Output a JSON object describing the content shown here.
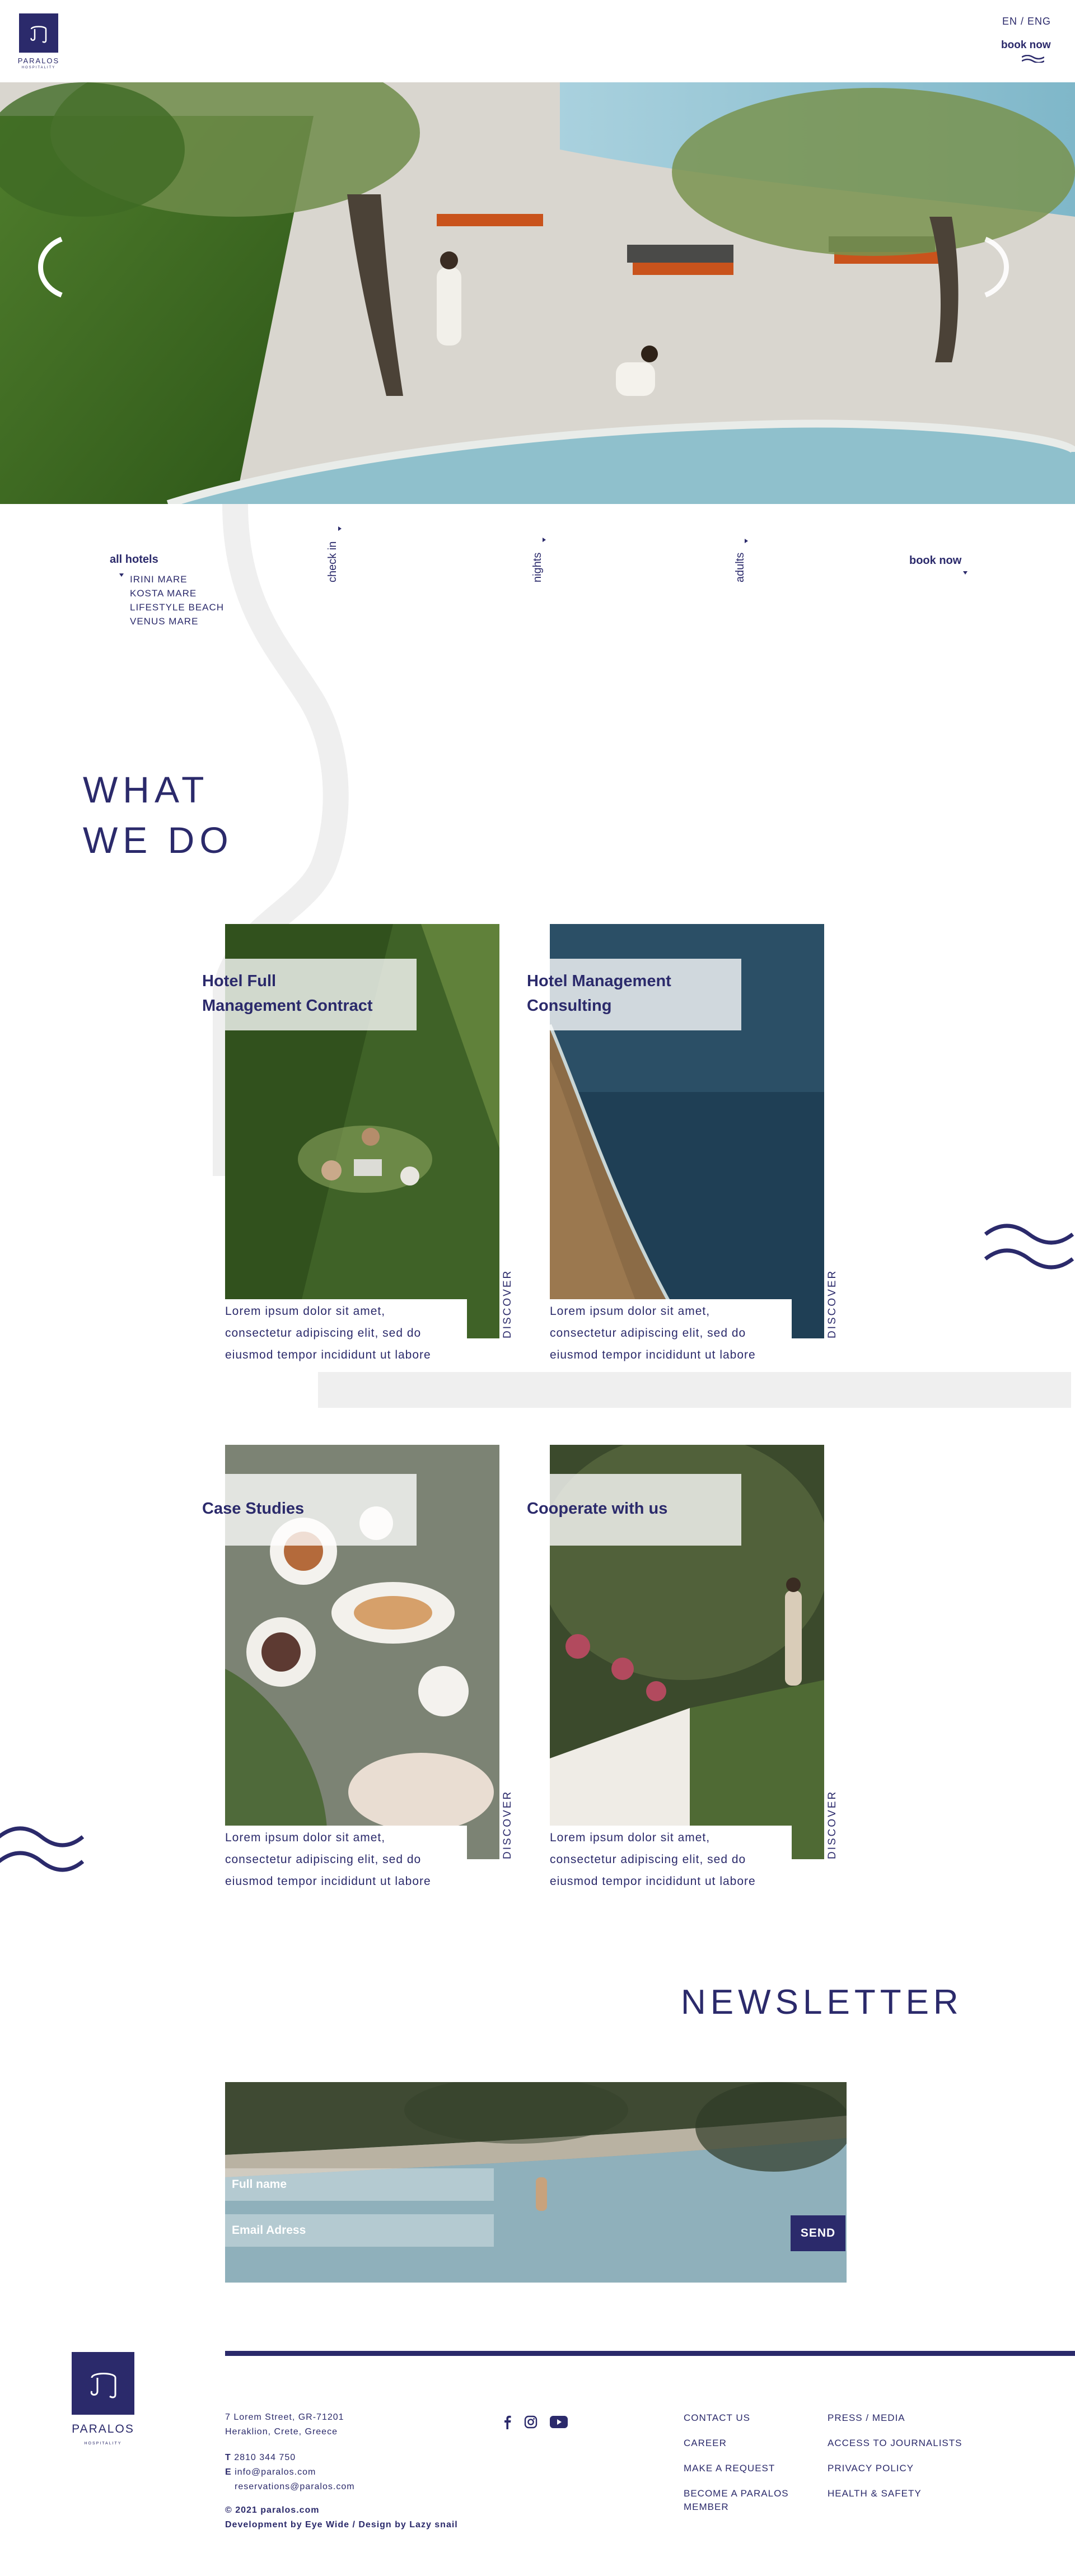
{
  "header": {
    "logo_text": "PARALOS",
    "logo_subtext": "HOSPITALITY",
    "language": "EN / ENG",
    "book_now": "book now"
  },
  "booking": {
    "hotels_label": "all hotels",
    "hotels": [
      "IRINI MARE",
      "KOSTA MARE",
      "LIFESTYLE BEACH",
      "VENUS MARE"
    ],
    "check_in": "check in",
    "nights": "nights",
    "adults": "adults",
    "book_now": "book now"
  },
  "what_we_do": {
    "title_line1": "WHAT",
    "title_line2": "WE DO",
    "cards": [
      {
        "title_line1": "Hotel Full",
        "title_line2": "Management Contract",
        "text_lines": [
          "Lorem ipsum dolor sit amet,",
          "consectetur adipiscing elit, sed do",
          "eiusmod tempor incididunt ut labore"
        ],
        "discover": "DISCOVER"
      },
      {
        "title_line1": "Hotel Management",
        "title_line2": "Consulting",
        "text_lines": [
          "Lorem ipsum dolor sit amet,",
          "consectetur adipiscing elit, sed do",
          "eiusmod tempor incididunt ut labore"
        ],
        "discover": "DISCOVER"
      },
      {
        "title_line1": "Case Studies",
        "title_line2": "",
        "text_lines": [
          "Lorem ipsum dolor sit amet,",
          "consectetur adipiscing elit, sed do",
          "eiusmod tempor incididunt ut labore"
        ],
        "discover": "DISCOVER"
      },
      {
        "title_line1": "Cooperate with us",
        "title_line2": "",
        "text_lines": [
          "Lorem ipsum dolor sit amet,",
          "consectetur adipiscing elit, sed do",
          "eiusmod tempor incididunt ut labore"
        ],
        "discover": "DISCOVER"
      }
    ]
  },
  "newsletter": {
    "title": "NEWSLETTER",
    "name_placeholder": "Full name",
    "email_placeholder": "Email Adress",
    "send": "SEND"
  },
  "footer": {
    "logo_text": "PARALOS",
    "logo_subtext": "HOSPITALITY",
    "address_line1": "7 Lorem Street, GR-71201",
    "address_line2": "Heraklion, Crete, Greece",
    "phone_label": "T",
    "phone": "2810 344 750",
    "email_label": "E",
    "email1": "info@paralos.com",
    "email2": "reservations@paralos.com",
    "copyright": "© 2021 paralos.com",
    "credits": "Development by Eye Wide / Design by Lazy snail",
    "links_col1": [
      "CONTACT US",
      "CAREER",
      "MAKE A REQUEST",
      "BECOME A PARALOS",
      "MEMBER"
    ],
    "links_col2": [
      "PRESS / MEDIA",
      "ACCESS TO JOURNALISTS",
      "PRIVACY POLICY",
      "HEALTH & SAFETY"
    ],
    "social": [
      "facebook-icon",
      "instagram-icon",
      "youtube-icon"
    ]
  },
  "colors": {
    "navy": "#2b2a6b",
    "light_gray": "#efefef",
    "white": "#ffffff"
  }
}
